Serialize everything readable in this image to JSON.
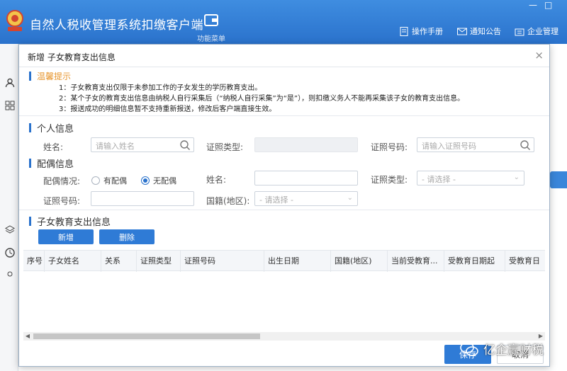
{
  "app": {
    "title": "自然人税收管理系统扣缴客户端",
    "func_menu_label": "功能菜单",
    "links": {
      "manual": "操作手册",
      "notice": "通知公告",
      "enterprise": "企业管理"
    },
    "window_controls": [
      "—",
      "□"
    ]
  },
  "modal": {
    "title": "新增 子女教育支出信息",
    "close": "×",
    "tips": {
      "title": "温馨提示",
      "lines": [
        "1：子女教育支出仅限于未参加工作的子女发生的学历教育支出。",
        "2：某个子女的教育支出信息由纳税人自行采集后（“纳税人自行采集”为“是”），则扣缴义务人不能再采集该子女的教育支出信息。",
        "3：报送成功的明细信息暂不支持重新报送，修改后客户端直接生效。"
      ]
    },
    "personal": {
      "title": "个人信息",
      "name_label": "姓名:",
      "name_placeholder": "请输入姓名",
      "idtype_label": "证照类型:",
      "idno_label": "证照号码:",
      "idno_placeholder": "请输入证照号码"
    },
    "spouse": {
      "title": "配偶信息",
      "status_label": "配偶情况:",
      "option_has": "有配偶",
      "option_none": "无配偶",
      "selected": "无配偶",
      "name_label": "姓名:",
      "idtype_label": "证照类型:",
      "idtype_placeholder": "- 请选择 -",
      "idno_label": "证照号码:",
      "nationality_label": "国籍(地区):",
      "nationality_placeholder": "- 请选择 -"
    },
    "children": {
      "title": "子女教育支出信息",
      "add_button": "新增",
      "delete_button": "删除",
      "columns": [
        "序号",
        "子女姓名",
        "关系",
        "证照类型",
        "证照号码",
        "出生日期",
        "国籍(地区)",
        "当前受教育...",
        "受教育日期起",
        "受教育日"
      ]
    },
    "footer": {
      "save": "保存",
      "cancel": "取消"
    }
  },
  "watermark": "亿企赢财税",
  "colors": {
    "primary": "#2f7bd6",
    "header": "#2a72cc",
    "tip": "#e7962e"
  }
}
